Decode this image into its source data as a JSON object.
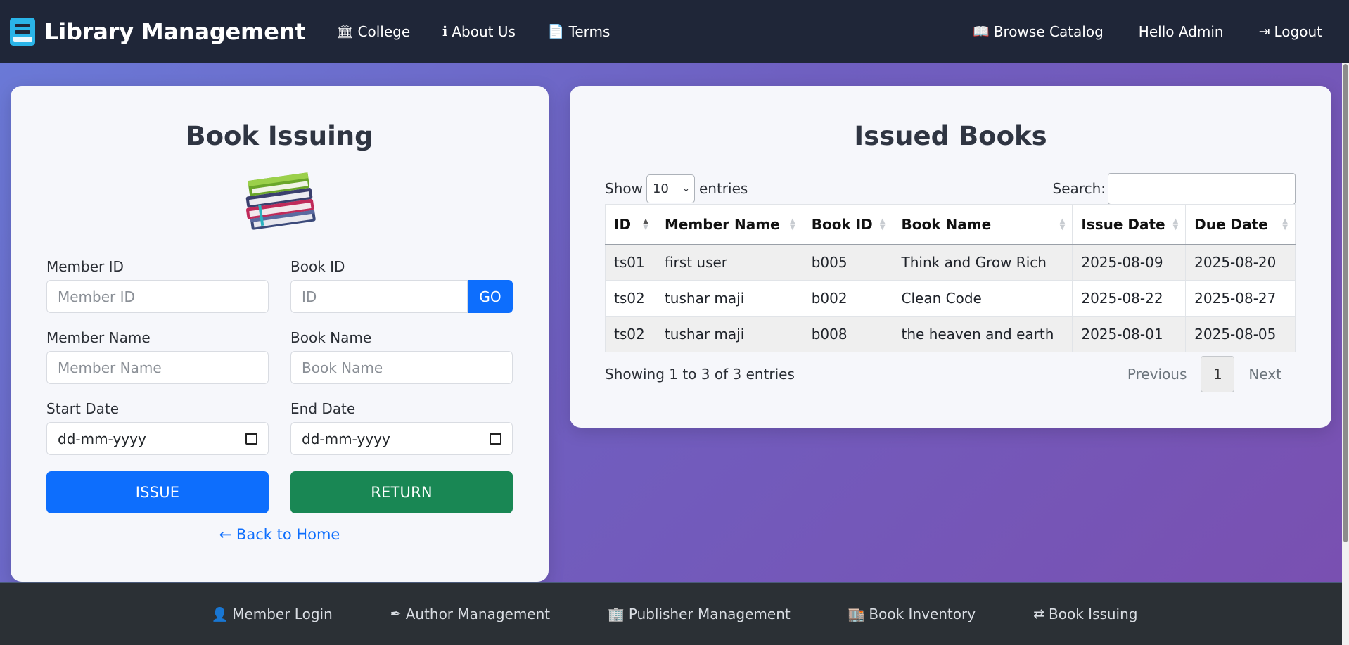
{
  "navbar": {
    "brand": "Library Management",
    "left_links": [
      {
        "label": "College",
        "icon": "🏛"
      },
      {
        "label": "About Us",
        "icon": "ℹ"
      },
      {
        "label": "Terms",
        "icon": "📄"
      }
    ],
    "right_links": [
      {
        "label": "Browse Catalog",
        "icon": "📖"
      },
      {
        "label": "Hello Admin"
      },
      {
        "label": "Logout",
        "icon": "⇥"
      }
    ]
  },
  "issue_form": {
    "title": "Book Issuing",
    "member_id_label": "Member ID",
    "member_id_placeholder": "Member ID",
    "book_id_label": "Book ID",
    "book_id_placeholder": "ID",
    "go_label": "GO",
    "member_name_label": "Member Name",
    "member_name_placeholder": "Member Name",
    "book_name_label": "Book Name",
    "book_name_placeholder": "Book Name",
    "start_date_label": "Start Date",
    "start_date_value": "dd-mm-yyyy",
    "end_date_label": "End Date",
    "end_date_value": "dd-mm-yyyy",
    "issue_label": "ISSUE",
    "return_label": "RETURN",
    "back_label": "Back to Home",
    "back_icon": "←"
  },
  "issued_books": {
    "title": "Issued Books",
    "show_label": "Show",
    "entries_label": "entries",
    "page_length": "10",
    "search_label": "Search:",
    "columns": [
      "ID",
      "Member Name",
      "Book ID",
      "Book Name",
      "Issue Date",
      "Due Date"
    ],
    "rows": [
      [
        "ts01",
        "first user",
        "b005",
        "Think and Grow Rich",
        "2025-08-09",
        "2025-08-20"
      ],
      [
        "ts02",
        "tushar maji",
        "b002",
        "Clean Code",
        "2025-08-22",
        "2025-08-27"
      ],
      [
        "ts02",
        "tushar maji",
        "b008",
        "the heaven and earth",
        "2025-08-01",
        "2025-08-05"
      ]
    ],
    "info": "Showing 1 to 3 of 3 entries",
    "previous_label": "Previous",
    "current_page": "1",
    "next_label": "Next"
  },
  "footer": {
    "links": [
      {
        "label": "Member Login",
        "icon": "👤"
      },
      {
        "label": "Author Management",
        "icon": "✒"
      },
      {
        "label": "Publisher Management",
        "icon": "🏢"
      },
      {
        "label": "Book Inventory",
        "icon": "🏬"
      },
      {
        "label": "Book Issuing",
        "icon": "⇄"
      }
    ]
  },
  "colors": {
    "navbar_bg": "#1f2638",
    "primary": "#0d6efd",
    "success": "#198754",
    "footer_bg": "#2b3035"
  }
}
